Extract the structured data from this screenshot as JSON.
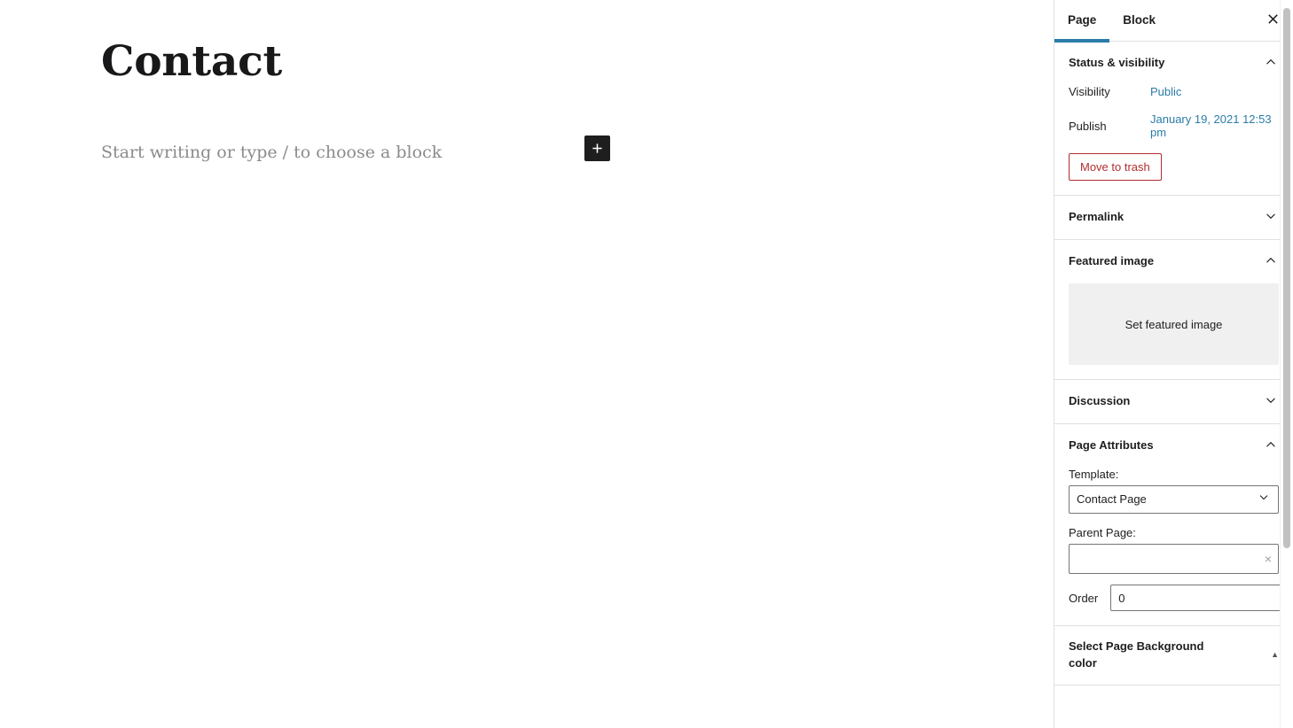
{
  "editor": {
    "post_title": "Contact",
    "block_placeholder": "Start writing or type / to choose a block",
    "add_block_label": "+"
  },
  "sidebar": {
    "tabs": [
      {
        "label": "Page",
        "active": true
      },
      {
        "label": "Block",
        "active": false
      }
    ],
    "close_label": "×",
    "panels": [
      {
        "key": "status_visibility",
        "title": "Status & visibility",
        "expanded": true,
        "rows": [
          {
            "label": "Visibility",
            "value": "Public"
          },
          {
            "label": "Publish",
            "value": "January 19, 2021 12:53 pm"
          }
        ],
        "trash_label": "Move to trash"
      },
      {
        "key": "permalink",
        "title": "Permalink",
        "expanded": false
      },
      {
        "key": "featured_image",
        "title": "Featured image",
        "expanded": true,
        "set_image_label": "Set featured image"
      },
      {
        "key": "discussion",
        "title": "Discussion",
        "expanded": false
      },
      {
        "key": "page_attributes",
        "title": "Page Attributes",
        "expanded": true,
        "template_label": "Template:",
        "template_value": "Contact Page",
        "template_options": [
          "Contact Page"
        ],
        "parent_label": "Parent Page:",
        "parent_value": "",
        "parent_clear_label": "×",
        "order_label": "Order",
        "order_value": "0"
      },
      {
        "key": "page_background_color",
        "title": "Select Page Background color",
        "expanded": true,
        "toggle_glyph": "▲"
      }
    ]
  },
  "colors": {
    "accent_blue": "#2a7ca8",
    "danger_red": "#b32d2e",
    "border": "#e0e0e0",
    "placeholder_gray": "#8b8b8b",
    "panel_fill": "#f0f0f0"
  }
}
